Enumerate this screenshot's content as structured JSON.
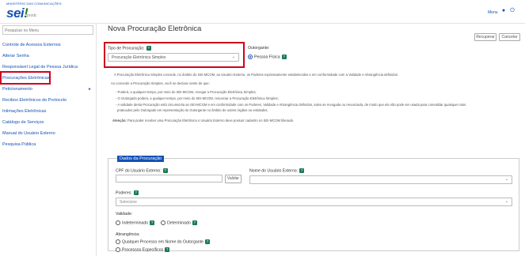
{
  "header": {
    "ministry": "MINISTÉRIO DAS COMUNICAÇÕES",
    "logo": "sei",
    "logo_mark": "!",
    "env": "prodc",
    "menu_label": "Menu"
  },
  "sidebar": {
    "search_placeholder": "Pesquisar no Menu",
    "items": [
      "Controle de Acessos Externos",
      "Alterar Senha",
      "Responsável Legal de Pessoa Jurídica",
      "Procurações Eletrônicas",
      "Peticionamento",
      "Recibos Eletrônicos de Protocolo",
      "Intimações Eletrônicas",
      "Catálogo de Serviços",
      "Manual do Usuário Externo",
      "Pesquisa Pública"
    ],
    "peticionamento_arrow": "▸"
  },
  "page": {
    "title": "Nova Procuração Eletrônica",
    "buttons": {
      "recuperar": "Recuperar",
      "cancelar": "Cancelar"
    }
  },
  "form": {
    "tipo_label": "Tipo de Procuração:",
    "tipo_value": "Procuração Eletrônica Simples",
    "outorgante_label": "Outorgante:",
    "outorgante_value": "Pessoa Física",
    "help_glyph": "?",
    "para1": "A Procuração Eletrônica Simples concede, no âmbito do SEI-MCOM, ao Usuário Externo, os Poderes expressamente estabelecidos e em conformidade com a Validade e Abrangência definidos.",
    "para2": "Ao conceder a Procuração Simples, você se declara ciente de que:",
    "bullets": [
      "- Poderá, a qualquer tempo, por meio do SEI-MCOM, revogar a Procuração Eletrônica Simples;",
      "- O Outorgado poderá, a qualquer tempo, por meio do SEI-MCOM, renunciar a Procuração Eletrônica Simples;",
      "- A validade desta Procuração está circunscrita ao SEI-MCOM e em conformidade com os Poderes, Validade e Abrangência definidos, salvo se revogada ou renunciada, de modo que ela não pode ser usada para convalidar quaisquer atos",
      "praticados pelo Outorgado em representação do Outorgante no âmbito de outros órgãos ou entidades."
    ],
    "attention_bold": "Atenção:",
    "attention_text": "Para poder receber uma Procuração Eletrônica o Usuário Externo deve possuir cadastro no SEI-MCOM liberado.",
    "fieldset_legend": "Dados da Procuração",
    "cpf_label": "CPF do Usuário Externo:",
    "validar": "Validar",
    "nome_label": "Nome do Usuário Externo:",
    "poderes_label": "Poderes:",
    "poderes_placeholder": "Selecione",
    "validade_label": "Validade:",
    "validade_opts": [
      "Indeterminado",
      "Determinado"
    ],
    "abrangencia_label": "Abrangência:",
    "abrangencia_opts": [
      "Qualquer Processo em Nome do Outorgante",
      "Processos Específicos"
    ]
  },
  "colors": {
    "accent": "#1351b4",
    "highlight": "#d0021b",
    "help": "#1a7a55"
  }
}
